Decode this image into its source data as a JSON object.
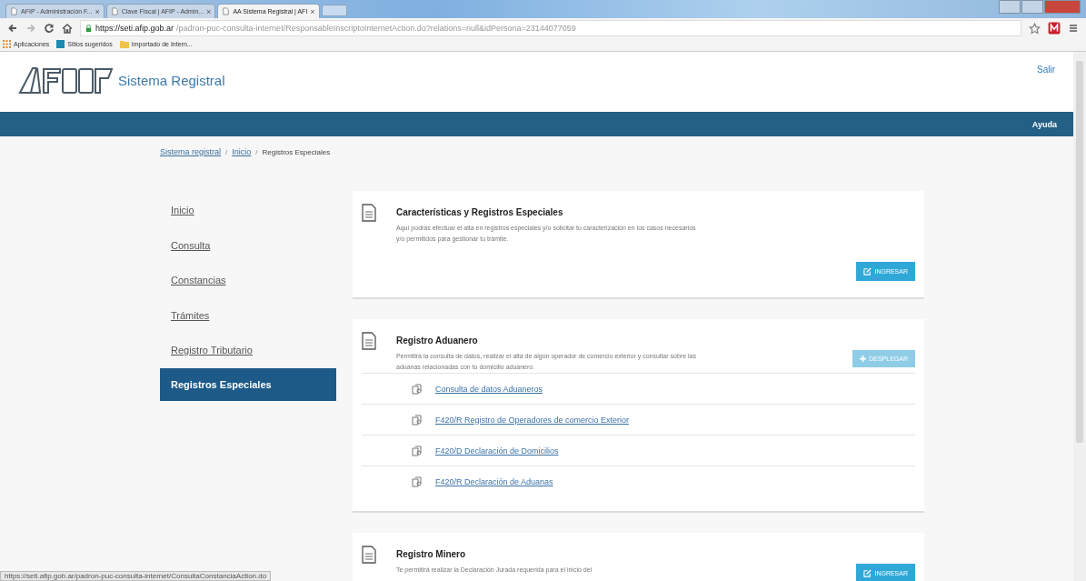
{
  "browser": {
    "tabs": [
      {
        "label": "AFIP - Administración F...",
        "selected": false
      },
      {
        "label": "Clave Fiscal | AFIP - Admin...",
        "selected": false
      },
      {
        "label": "AA Sistema Registral | AFI",
        "selected": true
      }
    ],
    "url_host": "https://seti.afip.gob.ar",
    "url_path": "/padron-puc-consulta-internet/ResponsableInscriptoInternetAction.do?relations=null&idPersona=23144077059",
    "close": "×",
    "bookmarks": [
      "Aplicaciones",
      "Sitios sugeridos",
      "Importado de Intern..."
    ]
  },
  "header": {
    "title": "Sistema Registral",
    "logout": "Salir",
    "help": "Ayuda"
  },
  "breadcrumb": [
    {
      "kind": "crumb",
      "label": "Sistema registral",
      "link": true
    },
    {
      "kind": "separator",
      "label": "/"
    },
    {
      "kind": "crumb",
      "label": "Inicio",
      "link": true
    },
    {
      "kind": "separator",
      "label": "/"
    },
    {
      "kind": "crumb",
      "label": "Registros Especiales",
      "link": false
    }
  ],
  "sidebar": {
    "items": [
      {
        "label": "Inicio",
        "selected": false
      },
      {
        "label": "Consulta",
        "selected": false
      },
      {
        "label": "Constancias",
        "selected": false
      },
      {
        "label": "Trámites",
        "selected": false
      },
      {
        "label": "Registro Tributario",
        "selected": false
      },
      {
        "label": "Registros Especiales",
        "selected": true
      }
    ]
  },
  "cards": [
    {
      "title": "Características y Registros Especiales",
      "text": "Aquí podrás efectuar el alta en registros especiales y/o solicitar tu caracterización en los casos necesarios y/o permitidos para gestionar tu trámite.",
      "button": {
        "kind": "enter",
        "label": "INGRESAR",
        "disabled": false
      }
    },
    {
      "title": "Registro Aduanero",
      "text": "Permitirá la consulta de datos, realizar el alta de algún operador de comercio exterior y consultar sobre las aduanas relacionadas con tu domicilio aduanero.",
      "button": {
        "kind": "expand",
        "label": "DESPLEGAR",
        "disabled": true
      },
      "links": [
        "Consulta de datos Aduaneros",
        "F420/R Registro de Operadores de comercio Exterior",
        "F420/D Declaración de Domicilios",
        "F420/R Declaración de Aduanas"
      ]
    },
    {
      "title": "Registro Minero",
      "text": "Te permitirá realizar la Declaración Jurada requerida para el inicio del",
      "button": {
        "kind": "enter",
        "label": "INGRESAR",
        "disabled": false
      }
    }
  ],
  "status_bar": "https://seti.afip.gob.ar/padron-puc-consulta-internet/ConsultaConstanciaAction.do"
}
